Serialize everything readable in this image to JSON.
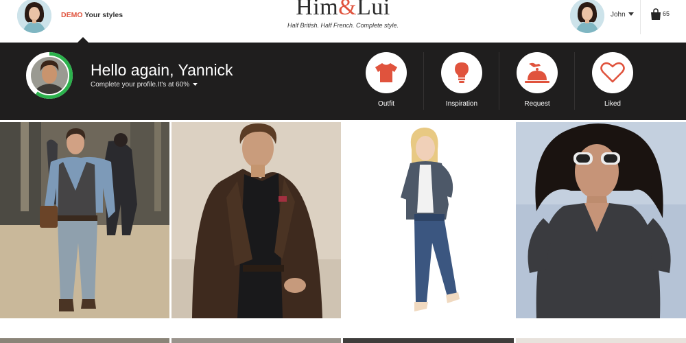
{
  "header": {
    "demo_tag": "DEMO",
    "demo_text": "Your styles",
    "logo_left": "Him",
    "logo_amp": "&",
    "logo_right": "Lui",
    "tagline": "Half British. Half French. Complete style.",
    "user_name": "John",
    "cart_count": "65",
    "icons": [
      "avatar",
      "chevron-down-icon",
      "shopping-bag-icon"
    ]
  },
  "profile": {
    "greeting": "Hello again, Yannick",
    "status": "Complete your profile.It's at 60%",
    "completion_percent": 60,
    "ring_color": "#2bb24c"
  },
  "actions": [
    {
      "label": "Outfit",
      "icon": "tshirt-icon"
    },
    {
      "label": "Inspiration",
      "icon": "lightbulb-icon"
    },
    {
      "label": "Request",
      "icon": "service-bell-icon"
    },
    {
      "label": "Liked",
      "icon": "heart-icon"
    }
  ],
  "colors": {
    "accent": "#e0533d",
    "band": "#1f1e1e",
    "progress": "#2bb24c"
  },
  "gallery": [
    {
      "subject": "man in grey waistcoat and jeans on runway"
    },
    {
      "subject": "man in brown blazer"
    },
    {
      "subject": "woman in denim jacket and jeans"
    },
    {
      "subject": "woman in sunglasses and grey blouse"
    }
  ]
}
